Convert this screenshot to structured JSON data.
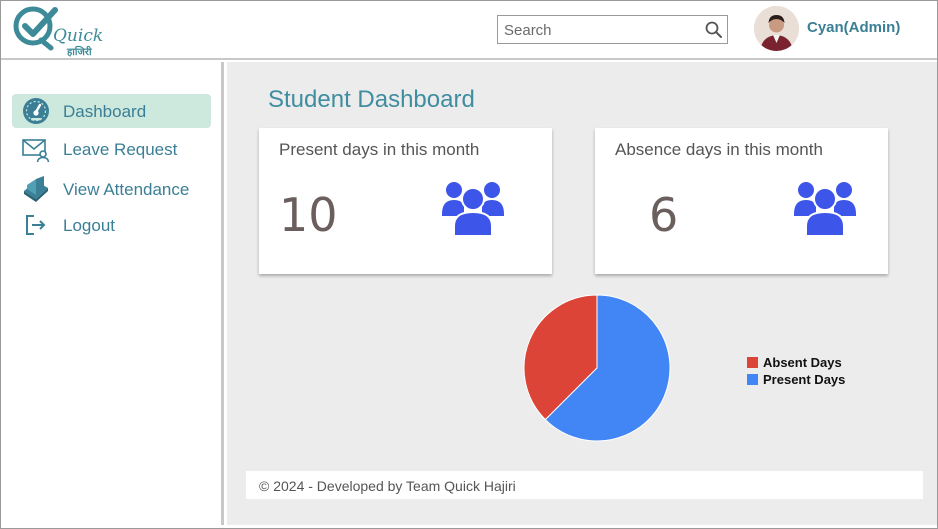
{
  "header": {
    "logo_top": "Quick",
    "logo_bottom": "हाजिरी",
    "search_placeholder": "Search",
    "user_name": "Cyan(Admin)"
  },
  "sidebar": {
    "items": [
      {
        "label": "Dashboard",
        "icon": "dashboard-gauge-icon",
        "active": true
      },
      {
        "label": "Leave Request",
        "icon": "mail-user-icon",
        "active": false
      },
      {
        "label": "View Attendance",
        "icon": "book-icon",
        "active": false
      },
      {
        "label": "Logout",
        "icon": "logout-icon",
        "active": false
      }
    ]
  },
  "main": {
    "title": "Student Dashboard",
    "cards": [
      {
        "title": "Present days in this month",
        "value": "10",
        "icon": "users-group-icon"
      },
      {
        "title": "Absence days in this month",
        "value": "6",
        "icon": "users-group-icon"
      }
    ]
  },
  "chart_data": {
    "type": "pie",
    "slices": [
      {
        "name": "Absent Days",
        "value": 6,
        "color": "#db4437"
      },
      {
        "name": "Present Days",
        "value": 10,
        "color": "#4285f4"
      }
    ],
    "title": "",
    "legend_position": "right"
  },
  "footer": {
    "text": "© 2024 - Developed by Team Quick Hajiri"
  },
  "colors": {
    "accent": "#3a7f95",
    "active_bg": "#cde8dc",
    "icon_blue": "#3d55e8"
  }
}
